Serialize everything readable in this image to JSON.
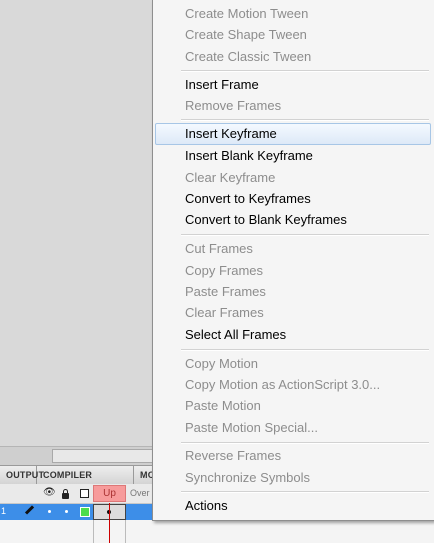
{
  "timeline": {
    "tabs": [
      "OUTPUT",
      "COMPILER ERRORS",
      "MO"
    ],
    "frame_label": "Up",
    "frame_label_next": "Over",
    "layer_number": "1",
    "colors": {
      "selected_layer": "#3d8ee8",
      "frame_label": "#f79b9b",
      "playhead": "#cc0000",
      "layer_color": "#4ddc4d"
    }
  },
  "menu": {
    "items": [
      {
        "label": "Create Motion Tween",
        "enabled": false
      },
      {
        "label": "Create Shape Tween",
        "enabled": false
      },
      {
        "label": "Create Classic Tween",
        "enabled": false
      },
      {
        "label": "Insert Frame",
        "enabled": true
      },
      {
        "label": "Remove Frames",
        "enabled": false
      },
      {
        "label": "Insert Keyframe",
        "enabled": true,
        "highlighted": true
      },
      {
        "label": "Insert Blank Keyframe",
        "enabled": true
      },
      {
        "label": "Clear Keyframe",
        "enabled": false
      },
      {
        "label": "Convert to Keyframes",
        "enabled": true
      },
      {
        "label": "Convert to Blank Keyframes",
        "enabled": true
      },
      {
        "label": "Cut Frames",
        "enabled": false
      },
      {
        "label": "Copy Frames",
        "enabled": false
      },
      {
        "label": "Paste Frames",
        "enabled": false
      },
      {
        "label": "Clear Frames",
        "enabled": false
      },
      {
        "label": "Select All Frames",
        "enabled": true
      },
      {
        "label": "Copy Motion",
        "enabled": false
      },
      {
        "label": "Copy Motion as ActionScript 3.0...",
        "enabled": false
      },
      {
        "label": "Paste Motion",
        "enabled": false
      },
      {
        "label": "Paste Motion Special...",
        "enabled": false
      },
      {
        "label": "Reverse Frames",
        "enabled": false
      },
      {
        "label": "Synchronize Symbols",
        "enabled": false
      },
      {
        "label": "Actions",
        "enabled": true
      }
    ]
  }
}
